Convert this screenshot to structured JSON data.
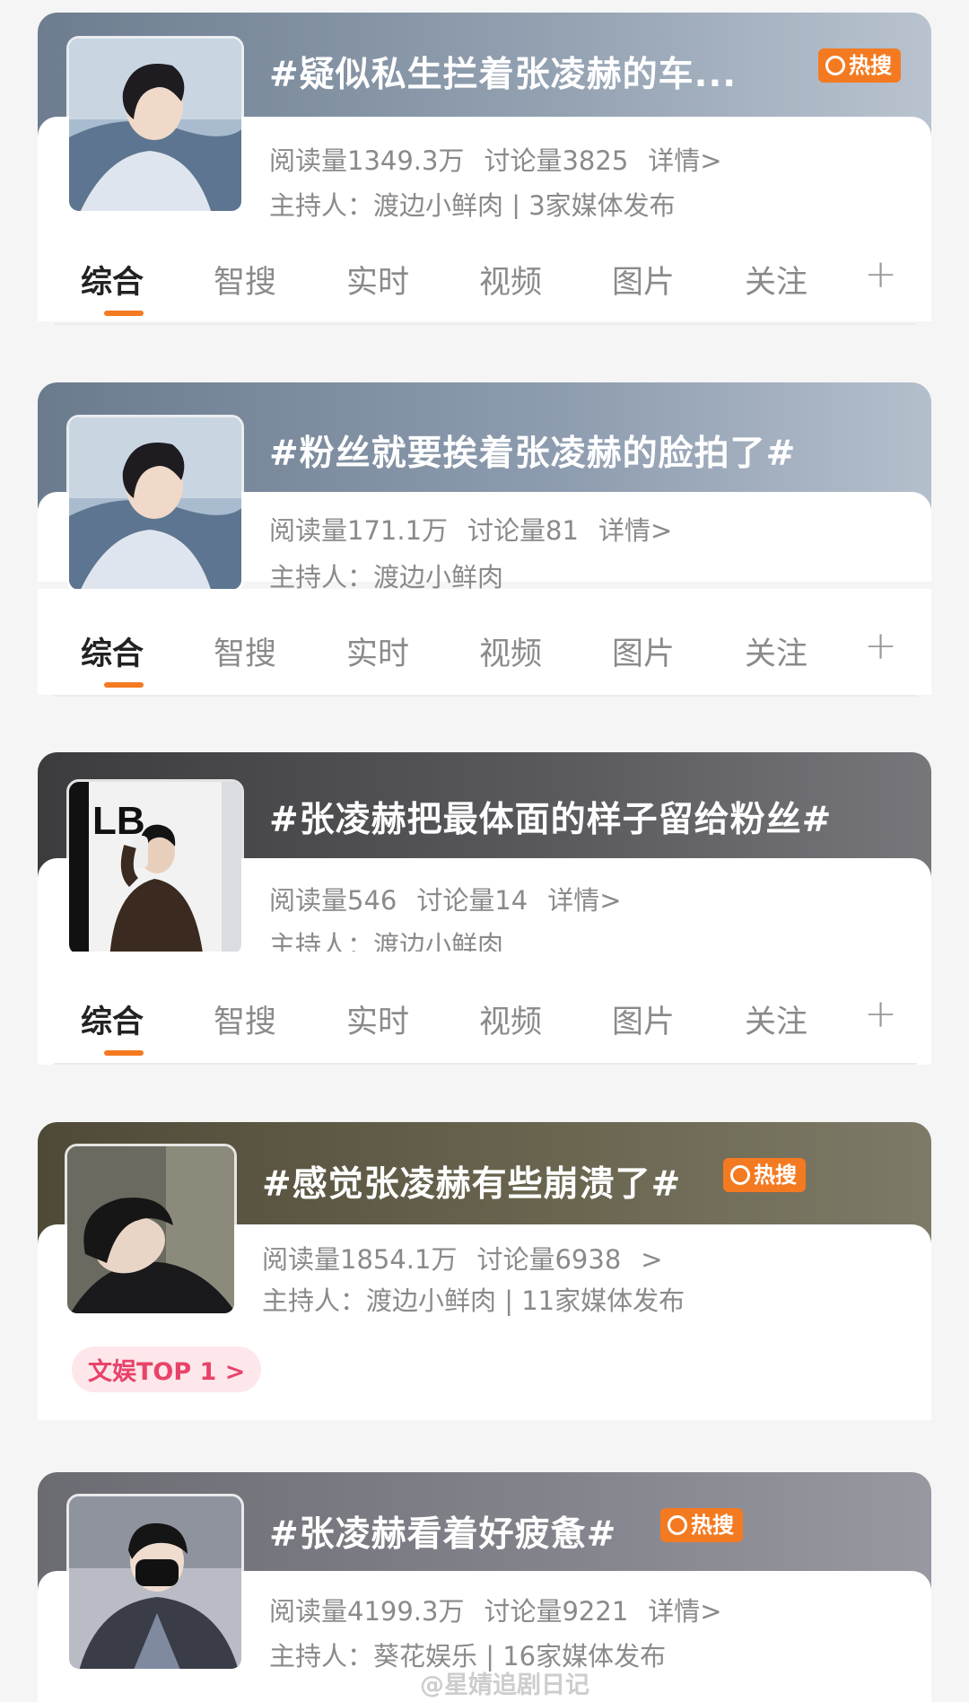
{
  "topics": [
    {
      "title": "#疑似私生拦着张凌赫的车...",
      "hot_badge": "热搜",
      "stats": [
        "阅读量1349.3万",
        "讨论量3825",
        "详情>"
      ],
      "host": "主持人：渡边小鲜肉 | 3家媒体发布"
    },
    {
      "title": "#粉丝就要挨着张凌赫的脸拍了#",
      "stats": [
        "阅读量171.1万",
        "讨论量81",
        "详情>"
      ],
      "host": "主持人：渡边小鲜肉"
    },
    {
      "title": "#张凌赫把最体面的样子留给粉丝#",
      "stats": [
        "阅读量546",
        "讨论量14",
        "详情>"
      ],
      "host": "主持人：渡边小鲜肉"
    },
    {
      "title": "#感觉张凌赫有些崩溃了#",
      "hot_badge": "热搜",
      "stats": [
        "阅读量1854.1万",
        "讨论量6938",
        ">"
      ],
      "host": "主持人：渡边小鲜肉 | 11家媒体发布",
      "rank_tag": "文娱TOP 1 >"
    },
    {
      "title": "#张凌赫看着好疲惫#",
      "hot_badge": "热搜",
      "stats": [
        "阅读量4199.3万",
        "讨论量9221",
        "详情>"
      ],
      "host": "主持人：葵花娱乐 | 16家媒体发布"
    }
  ],
  "tabs": [
    "综合",
    "智搜",
    "实时",
    "视频",
    "图片",
    "关注"
  ],
  "tab_plus": "+",
  "watermark": "@星婧追剧日记",
  "colors": {
    "accent": "#f47a21",
    "tag_text": "#e8436a"
  }
}
